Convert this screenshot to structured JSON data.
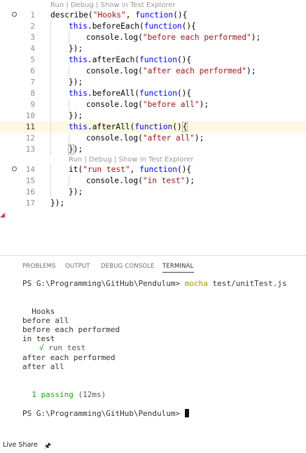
{
  "editor": {
    "codelens_1": "Run | Debug | Show in Test Explorer",
    "codelens_2": "Run | Debug | Show in Test Explorer",
    "lines": [
      {
        "n": "1"
      },
      {
        "n": "2"
      },
      {
        "n": "3"
      },
      {
        "n": "4"
      },
      {
        "n": "5"
      },
      {
        "n": "6"
      },
      {
        "n": "7"
      },
      {
        "n": "8"
      },
      {
        "n": "9"
      },
      {
        "n": "10"
      },
      {
        "n": "11"
      },
      {
        "n": "12"
      },
      {
        "n": "13"
      },
      {
        "n": "14"
      },
      {
        "n": "15"
      },
      {
        "n": "16"
      },
      {
        "n": "17"
      }
    ],
    "code": {
      "l1_a": "describe(",
      "l1_s": "\"Hooks\"",
      "l1_b": ", ",
      "l1_k": "function",
      "l1_c": "(){",
      "l2_k": "this",
      "l2_a": ".beforeEach(",
      "l2_k2": "function",
      "l2_b": "(){",
      "l3_a": "console.log(",
      "l3_s": "\"before each performed\"",
      "l3_b": ");",
      "l4": "});",
      "l5_k": "this",
      "l5_a": ".afterEach(",
      "l5_k2": "function",
      "l5_b": "(){",
      "l6_a": "console.log(",
      "l6_s": "\"after each performed\"",
      "l6_b": ");",
      "l7": "});",
      "l8_k": "this",
      "l8_a": ".beforeAll(",
      "l8_k2": "function",
      "l8_b": "(){",
      "l9_a": "console.log(",
      "l9_s": "\"before all\"",
      "l9_b": ");",
      "l10": "});",
      "l11_k": "this",
      "l11_a": ".afterAll(",
      "l11_k2": "function",
      "l11_b": "()",
      "l11_c": "{",
      "l12_a": "console.log(",
      "l12_s": "\"after all\"",
      "l12_b": ");",
      "l13_a": "}",
      "l13_b": ");",
      "l14_a": "it(",
      "l14_s": "\"run test\"",
      "l14_b": ", ",
      "l14_k": "function",
      "l14_c": "(){",
      "l15_a": "console.log(",
      "l15_s": "\"in test\"",
      "l15_b": ");",
      "l16": "});",
      "l17": "});"
    }
  },
  "panel": {
    "tabs": [
      "PROBLEMS",
      "OUTPUT",
      "DEBUG CONSOLE",
      "TERMINAL"
    ],
    "active_tab": "TERMINAL"
  },
  "terminal": {
    "prompt_1": "PS G:\\Programming\\GitHub\\Pendulum> ",
    "cmd": "mocha",
    "cmd_args": " test/unitTest.js",
    "suite": "  Hooks",
    "out_1": "before all",
    "out_2": "before each performed",
    "out_3": "in test",
    "check": "√",
    "test_name": " run test",
    "out_4": "after each performed",
    "out_5": "after all",
    "passing": "  1 passing",
    "duration": " (12ms)",
    "prompt_2": "PS G:\\Programming\\GitHub\\Pendulum> "
  },
  "status": {
    "live_share": "Live Share",
    "pin_icon": "pin-icon"
  },
  "colors": {
    "keyword": "#0000ff",
    "string": "#a31515",
    "line_highlight": "#fcf9e0",
    "terminal_yellow": "#9b9b00",
    "terminal_green": "#17a617"
  }
}
